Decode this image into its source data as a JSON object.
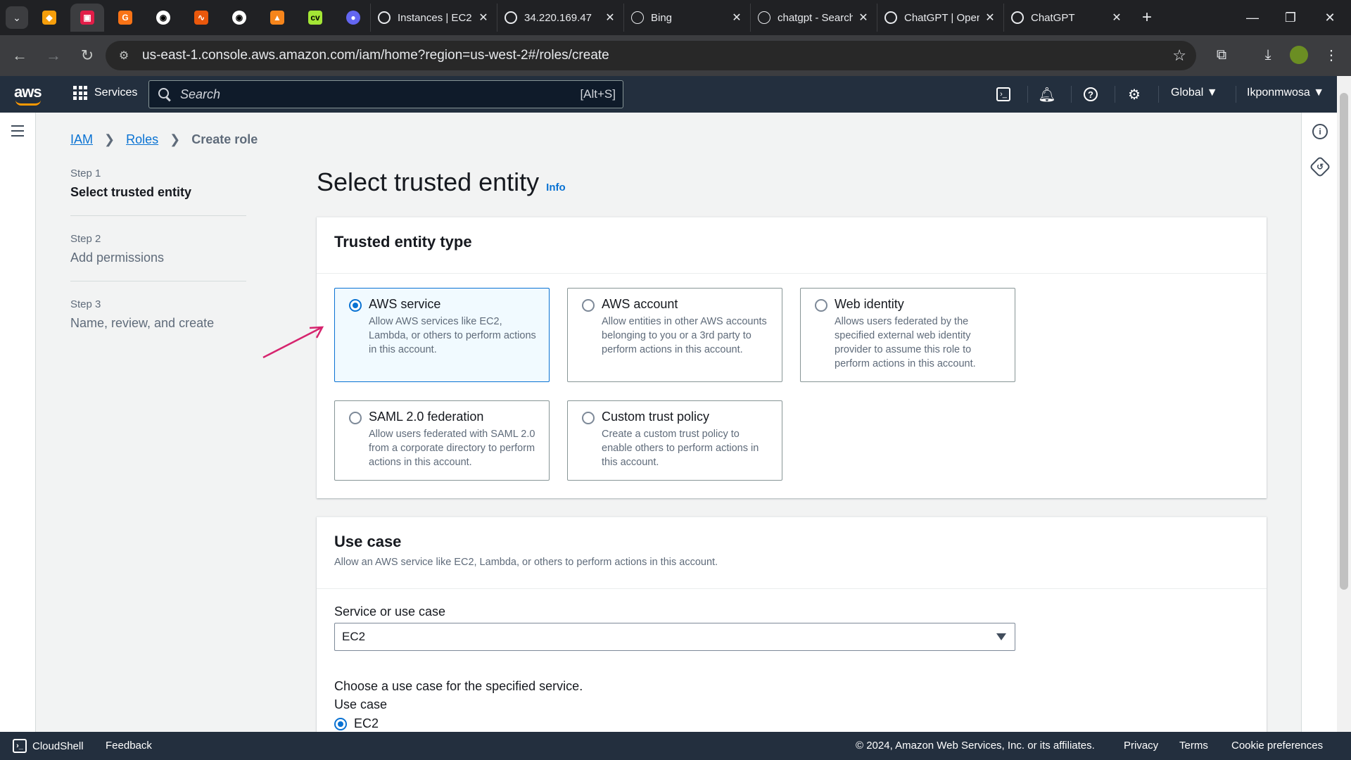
{
  "browser": {
    "tabs": [
      {
        "label": "Instances | EC2",
        "close": "✕"
      },
      {
        "label": "34.220.169.47",
        "close": "✕"
      },
      {
        "label": "Bing",
        "close": "✕"
      },
      {
        "label": "chatgpt - Search",
        "close": "✕"
      },
      {
        "label": "ChatGPT | OpenAI",
        "close": "✕"
      },
      {
        "label": "ChatGPT",
        "close": "✕"
      }
    ],
    "new_tab": "+",
    "url": "us-east-1.console.aws.amazon.com/iam/home?region=us-west-2#/roles/create"
  },
  "aws_header": {
    "logo": "aws",
    "services_label": "Services",
    "search_placeholder": "Search",
    "search_shortcut": "[Alt+S]",
    "region": "Global ▼",
    "user": "Ikponmwosa ▼"
  },
  "breadcrumb": {
    "items": [
      "IAM",
      "Roles"
    ],
    "current": "Create role"
  },
  "steps": [
    {
      "num": "Step 1",
      "title": "Select trusted entity"
    },
    {
      "num": "Step 2",
      "title": "Add permissions"
    },
    {
      "num": "Step 3",
      "title": "Name, review, and create"
    }
  ],
  "page": {
    "title": "Select trusted entity",
    "info": "Info"
  },
  "trusted_entity": {
    "heading": "Trusted entity type",
    "options": [
      {
        "title": "AWS service",
        "desc": "Allow AWS services like EC2, Lambda, or others to perform actions in this account.",
        "selected": true
      },
      {
        "title": "AWS account",
        "desc": "Allow entities in other AWS accounts belonging to you or a 3rd party to perform actions in this account.",
        "selected": false
      },
      {
        "title": "Web identity",
        "desc": "Allows users federated by the specified external web identity provider to assume this role to perform actions in this account.",
        "selected": false
      },
      {
        "title": "SAML 2.0 federation",
        "desc": "Allow users federated with SAML 2.0 from a corporate directory to perform actions in this account.",
        "selected": false
      },
      {
        "title": "Custom trust policy",
        "desc": "Create a custom trust policy to enable others to perform actions in this account.",
        "selected": false
      }
    ]
  },
  "use_case": {
    "heading": "Use case",
    "desc": "Allow an AWS service like EC2, Lambda, or others to perform actions in this account.",
    "service_label": "Service or use case",
    "service_value": "EC2",
    "choose_label": "Choose a use case for the specified service.",
    "use_case_label": "Use case",
    "selected_use_case": "EC2"
  },
  "footer": {
    "cloudshell": "CloudShell",
    "feedback": "Feedback",
    "copyright": "© 2024, Amazon Web Services, Inc. or its affiliates.",
    "privacy": "Privacy",
    "terms": "Terms",
    "cookies": "Cookie preferences"
  },
  "colors": {
    "aws_header": "#232f3e",
    "link_blue": "#0972d3",
    "annotation_arrow": "#d6246e"
  }
}
